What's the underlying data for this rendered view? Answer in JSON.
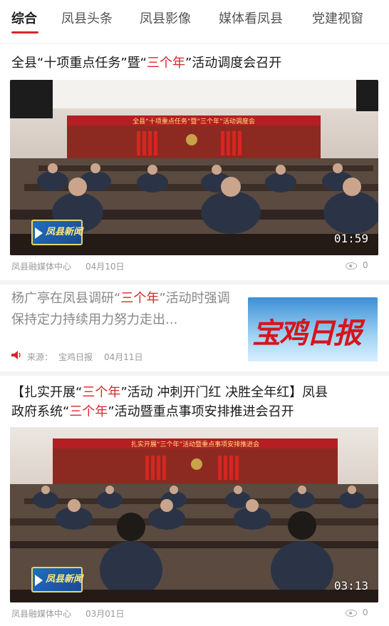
{
  "tabs": [
    {
      "label": "综合",
      "active": true
    },
    {
      "label": "凤县头条"
    },
    {
      "label": "凤县影像"
    },
    {
      "label": "媒体看凤县"
    },
    {
      "label": "党建视窗"
    }
  ],
  "articles": [
    {
      "title_parts": [
        "全县“十项重点任务”暨“",
        "三个年",
        "”活动调度会召开"
      ],
      "video_duration": "01:59",
      "video_badge": "凤县新闻",
      "banner_text": "全县“十项重点任务”暨“三个年”活动调度会",
      "source": "凤县融媒体中心",
      "date": "04月10日",
      "views": "0"
    },
    {
      "title_parts": [
        "杨广亭在凤县调研“",
        "三个年",
        "”活动时强调 保持定力持续用力努力走出..."
      ],
      "thumbnail_text": "宝鸡日报",
      "source_label": "来源：",
      "source": "宝鸡日报",
      "date": "04月11日"
    },
    {
      "title_line1_parts": [
        "【扎实开展“",
        "三个年",
        "”活动 冲刺开门红 决胜全年红】凤县"
      ],
      "title_line2_parts": [
        "政府系统“",
        "三个年",
        "”活动暨重点事项安排推进会召开"
      ],
      "video_duration": "03:13",
      "video_badge": "凤县新闻",
      "banner_text": "扎实开展“三个年”活动暨重点事项安排推进会",
      "source": "凤县融媒体中心",
      "date": "03月01日",
      "views": "0"
    }
  ],
  "colors": {
    "accent": "#d7262b",
    "meta": "#9a9a9a"
  },
  "icons": [
    "play-icon",
    "eye-icon",
    "speaker-icon"
  ]
}
